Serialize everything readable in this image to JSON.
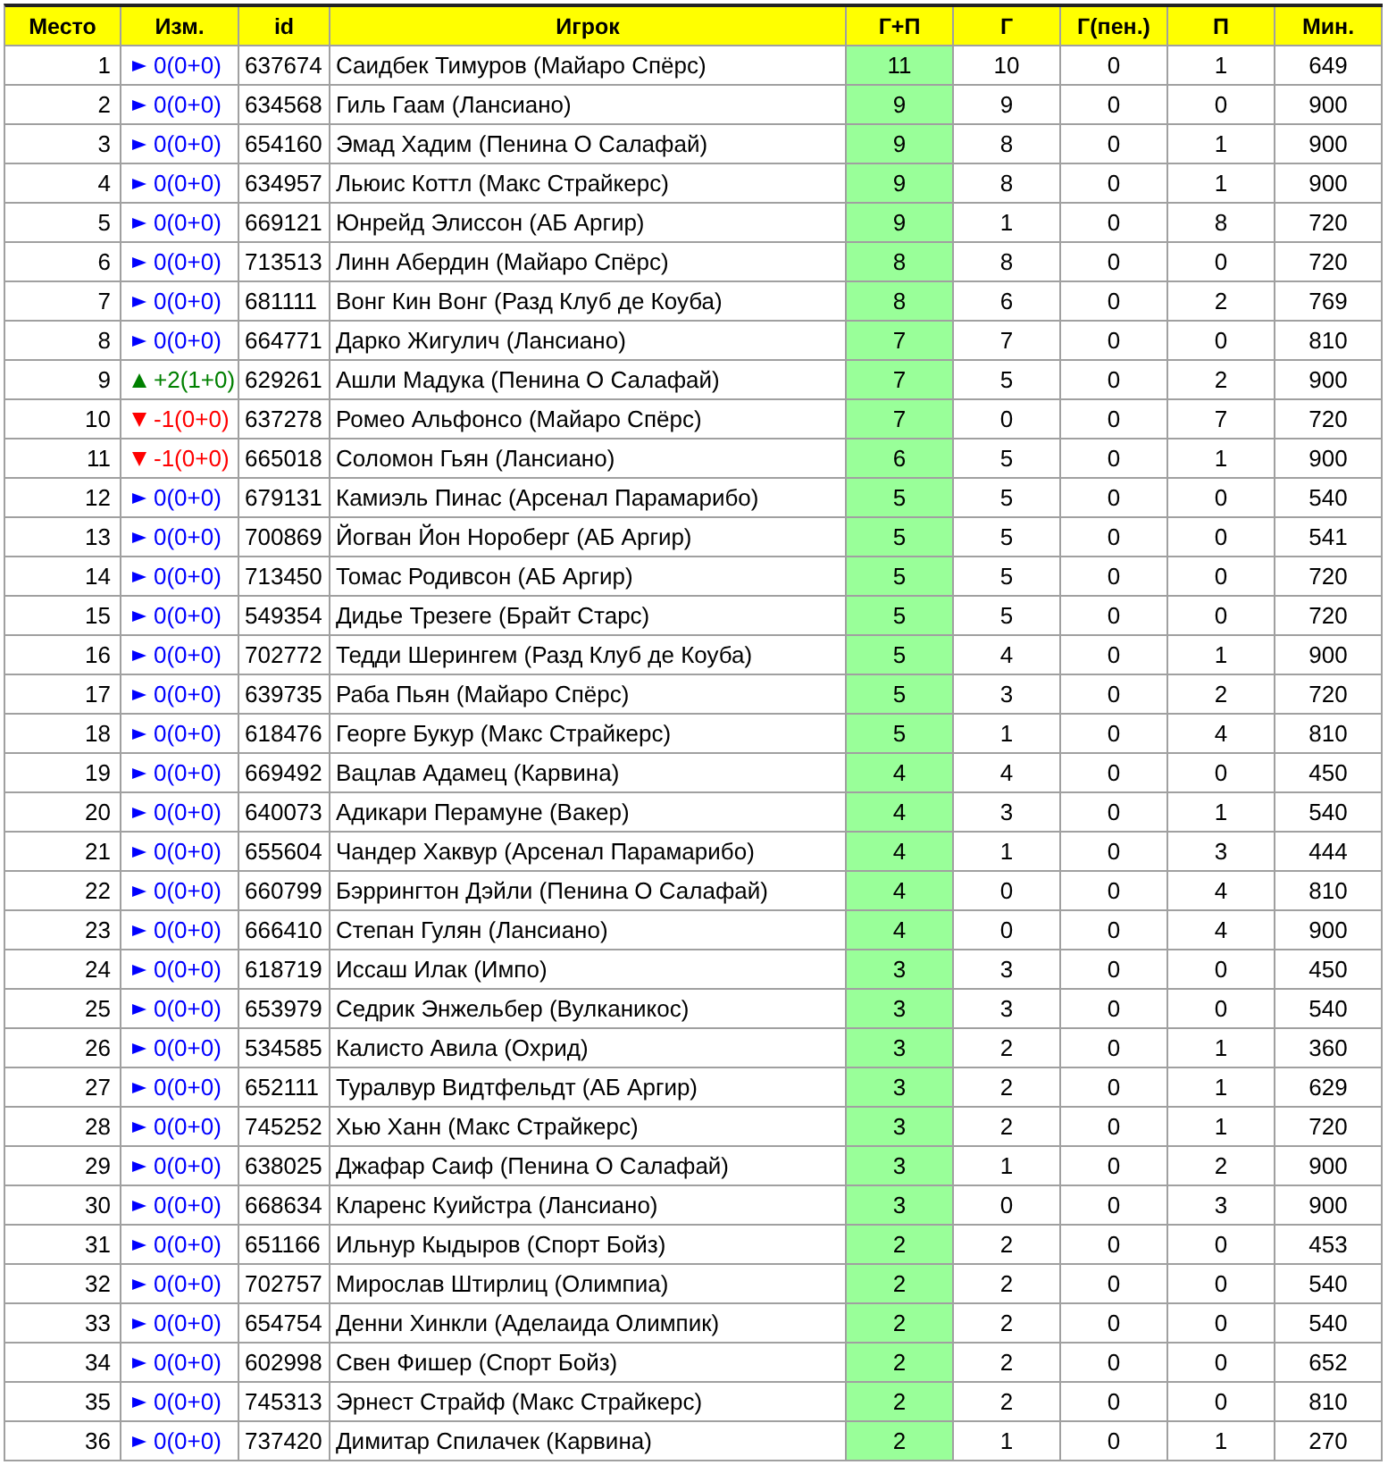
{
  "table": {
    "columns": [
      "Место",
      "Изм.",
      "id",
      "Игрок",
      "Г+П",
      "Г",
      "Г(пен.)",
      "П",
      "Мин."
    ],
    "rows": [
      {
        "place": "1",
        "change": {
          "kind": "same",
          "text": "0(0+0)"
        },
        "id": "637674",
        "player": "Саидбек Тимуров (Майаро Спёрс)",
        "gp": "11",
        "g": "10",
        "g_pen": "0",
        "a": "1",
        "min": "649"
      },
      {
        "place": "2",
        "change": {
          "kind": "same",
          "text": "0(0+0)"
        },
        "id": "634568",
        "player": "Гиль Гаам (Лансиано)",
        "gp": "9",
        "g": "9",
        "g_pen": "0",
        "a": "0",
        "min": "900"
      },
      {
        "place": "3",
        "change": {
          "kind": "same",
          "text": "0(0+0)"
        },
        "id": "654160",
        "player": "Эмад Хадим (Пенина О Салафай)",
        "gp": "9",
        "g": "8",
        "g_pen": "0",
        "a": "1",
        "min": "900"
      },
      {
        "place": "4",
        "change": {
          "kind": "same",
          "text": "0(0+0)"
        },
        "id": "634957",
        "player": "Льюис Коттл (Макс Страйкерс)",
        "gp": "9",
        "g": "8",
        "g_pen": "0",
        "a": "1",
        "min": "900"
      },
      {
        "place": "5",
        "change": {
          "kind": "same",
          "text": "0(0+0)"
        },
        "id": "669121",
        "player": "Юнрейд Элиссон (АБ Аргир)",
        "gp": "9",
        "g": "1",
        "g_pen": "0",
        "a": "8",
        "min": "720"
      },
      {
        "place": "6",
        "change": {
          "kind": "same",
          "text": "0(0+0)"
        },
        "id": "713513",
        "player": "Линн Абердин (Майаро Спёрс)",
        "gp": "8",
        "g": "8",
        "g_pen": "0",
        "a": "0",
        "min": "720"
      },
      {
        "place": "7",
        "change": {
          "kind": "same",
          "text": "0(0+0)"
        },
        "id": "681111",
        "player": "Вонг Кин Вонг (Разд Клуб де Коуба)",
        "gp": "8",
        "g": "6",
        "g_pen": "0",
        "a": "2",
        "min": "769"
      },
      {
        "place": "8",
        "change": {
          "kind": "same",
          "text": "0(0+0)"
        },
        "id": "664771",
        "player": "Дарко Жигулич (Лансиано)",
        "gp": "7",
        "g": "7",
        "g_pen": "0",
        "a": "0",
        "min": "810"
      },
      {
        "place": "9",
        "change": {
          "kind": "up",
          "text": "+2(1+0)"
        },
        "id": "629261",
        "player": "Ашли Мадука (Пенина О Салафай)",
        "gp": "7",
        "g": "5",
        "g_pen": "0",
        "a": "2",
        "min": "900"
      },
      {
        "place": "10",
        "change": {
          "kind": "down",
          "text": "-1(0+0)"
        },
        "id": "637278",
        "player": "Ромео Альфонсо (Майаро Спёрс)",
        "gp": "7",
        "g": "0",
        "g_pen": "0",
        "a": "7",
        "min": "720"
      },
      {
        "place": "11",
        "change": {
          "kind": "down",
          "text": "-1(0+0)"
        },
        "id": "665018",
        "player": "Соломон Гьян (Лансиано)",
        "gp": "6",
        "g": "5",
        "g_pen": "0",
        "a": "1",
        "min": "900"
      },
      {
        "place": "12",
        "change": {
          "kind": "same",
          "text": "0(0+0)"
        },
        "id": "679131",
        "player": "Камиэль Пинас (Арсенал Парамарибо)",
        "gp": "5",
        "g": "5",
        "g_pen": "0",
        "a": "0",
        "min": "540"
      },
      {
        "place": "13",
        "change": {
          "kind": "same",
          "text": "0(0+0)"
        },
        "id": "700869",
        "player": "Йогван Йон Нороберг (АБ Аргир)",
        "gp": "5",
        "g": "5",
        "g_pen": "0",
        "a": "0",
        "min": "541"
      },
      {
        "place": "14",
        "change": {
          "kind": "same",
          "text": "0(0+0)"
        },
        "id": "713450",
        "player": "Томас Родивсон (АБ Аргир)",
        "gp": "5",
        "g": "5",
        "g_pen": "0",
        "a": "0",
        "min": "720"
      },
      {
        "place": "15",
        "change": {
          "kind": "same",
          "text": "0(0+0)"
        },
        "id": "549354",
        "player": "Дидье Трезеге (Брайт Старс)",
        "gp": "5",
        "g": "5",
        "g_pen": "0",
        "a": "0",
        "min": "720"
      },
      {
        "place": "16",
        "change": {
          "kind": "same",
          "text": "0(0+0)"
        },
        "id": "702772",
        "player": "Тедди Шерингем (Разд Клуб де Коуба)",
        "gp": "5",
        "g": "4",
        "g_pen": "0",
        "a": "1",
        "min": "900"
      },
      {
        "place": "17",
        "change": {
          "kind": "same",
          "text": "0(0+0)"
        },
        "id": "639735",
        "player": "Раба Пьян (Майаро Спёрс)",
        "gp": "5",
        "g": "3",
        "g_pen": "0",
        "a": "2",
        "min": "720"
      },
      {
        "place": "18",
        "change": {
          "kind": "same",
          "text": "0(0+0)"
        },
        "id": "618476",
        "player": "Георге Букур (Макс Страйкерс)",
        "gp": "5",
        "g": "1",
        "g_pen": "0",
        "a": "4",
        "min": "810"
      },
      {
        "place": "19",
        "change": {
          "kind": "same",
          "text": "0(0+0)"
        },
        "id": "669492",
        "player": "Вацлав Адамец (Карвина)",
        "gp": "4",
        "g": "4",
        "g_pen": "0",
        "a": "0",
        "min": "450"
      },
      {
        "place": "20",
        "change": {
          "kind": "same",
          "text": "0(0+0)"
        },
        "id": "640073",
        "player": "Адикари Перамуне (Вакер)",
        "gp": "4",
        "g": "3",
        "g_pen": "0",
        "a": "1",
        "min": "540"
      },
      {
        "place": "21",
        "change": {
          "kind": "same",
          "text": "0(0+0)"
        },
        "id": "655604",
        "player": "Чандер Хаквур (Арсенал Парамарибо)",
        "gp": "4",
        "g": "1",
        "g_pen": "0",
        "a": "3",
        "min": "444"
      },
      {
        "place": "22",
        "change": {
          "kind": "same",
          "text": "0(0+0)"
        },
        "id": "660799",
        "player": "Бэррингтон Дэйли (Пенина О Салафай)",
        "gp": "4",
        "g": "0",
        "g_pen": "0",
        "a": "4",
        "min": "810"
      },
      {
        "place": "23",
        "change": {
          "kind": "same",
          "text": "0(0+0)"
        },
        "id": "666410",
        "player": "Степан Гулян (Лансиано)",
        "gp": "4",
        "g": "0",
        "g_pen": "0",
        "a": "4",
        "min": "900"
      },
      {
        "place": "24",
        "change": {
          "kind": "same",
          "text": "0(0+0)"
        },
        "id": "618719",
        "player": "Иссаш Илак (Импо)",
        "gp": "3",
        "g": "3",
        "g_pen": "0",
        "a": "0",
        "min": "450"
      },
      {
        "place": "25",
        "change": {
          "kind": "same",
          "text": "0(0+0)"
        },
        "id": "653979",
        "player": "Седрик Энжельбер (Вулканикос)",
        "gp": "3",
        "g": "3",
        "g_pen": "0",
        "a": "0",
        "min": "540"
      },
      {
        "place": "26",
        "change": {
          "kind": "same",
          "text": "0(0+0)"
        },
        "id": "534585",
        "player": "Калисто Авила (Охрид)",
        "gp": "3",
        "g": "2",
        "g_pen": "0",
        "a": "1",
        "min": "360"
      },
      {
        "place": "27",
        "change": {
          "kind": "same",
          "text": "0(0+0)"
        },
        "id": "652111",
        "player": "Туралвур Видтфельдт (АБ Аргир)",
        "gp": "3",
        "g": "2",
        "g_pen": "0",
        "a": "1",
        "min": "629"
      },
      {
        "place": "28",
        "change": {
          "kind": "same",
          "text": "0(0+0)"
        },
        "id": "745252",
        "player": "Хью Ханн (Макс Страйкерс)",
        "gp": "3",
        "g": "2",
        "g_pen": "0",
        "a": "1",
        "min": "720"
      },
      {
        "place": "29",
        "change": {
          "kind": "same",
          "text": "0(0+0)"
        },
        "id": "638025",
        "player": "Джафар Саиф (Пенина О Салафай)",
        "gp": "3",
        "g": "1",
        "g_pen": "0",
        "a": "2",
        "min": "900"
      },
      {
        "place": "30",
        "change": {
          "kind": "same",
          "text": "0(0+0)"
        },
        "id": "668634",
        "player": "Кларенс Куийстра (Лансиано)",
        "gp": "3",
        "g": "0",
        "g_pen": "0",
        "a": "3",
        "min": "900"
      },
      {
        "place": "31",
        "change": {
          "kind": "same",
          "text": "0(0+0)"
        },
        "id": "651166",
        "player": "Ильнур Кыдыров (Спорт Бойз)",
        "gp": "2",
        "g": "2",
        "g_pen": "0",
        "a": "0",
        "min": "453"
      },
      {
        "place": "32",
        "change": {
          "kind": "same",
          "text": "0(0+0)"
        },
        "id": "702757",
        "player": "Мирослав Штирлиц (Олимпиа)",
        "gp": "2",
        "g": "2",
        "g_pen": "0",
        "a": "0",
        "min": "540"
      },
      {
        "place": "33",
        "change": {
          "kind": "same",
          "text": "0(0+0)"
        },
        "id": "654754",
        "player": "Денни Хинкли (Аделаида Олимпик)",
        "gp": "2",
        "g": "2",
        "g_pen": "0",
        "a": "0",
        "min": "540"
      },
      {
        "place": "34",
        "change": {
          "kind": "same",
          "text": "0(0+0)"
        },
        "id": "602998",
        "player": "Свен Фишер (Спорт Бойз)",
        "gp": "2",
        "g": "2",
        "g_pen": "0",
        "a": "0",
        "min": "652"
      },
      {
        "place": "35",
        "change": {
          "kind": "same",
          "text": "0(0+0)"
        },
        "id": "745313",
        "player": "Эрнест Страйф (Макс Страйкерс)",
        "gp": "2",
        "g": "2",
        "g_pen": "0",
        "a": "0",
        "min": "810"
      },
      {
        "place": "36",
        "change": {
          "kind": "same",
          "text": "0(0+0)"
        },
        "id": "737420",
        "player": "Димитар Спилачек (Карвина)",
        "gp": "2",
        "g": "1",
        "g_pen": "0",
        "a": "1",
        "min": "270"
      }
    ]
  }
}
